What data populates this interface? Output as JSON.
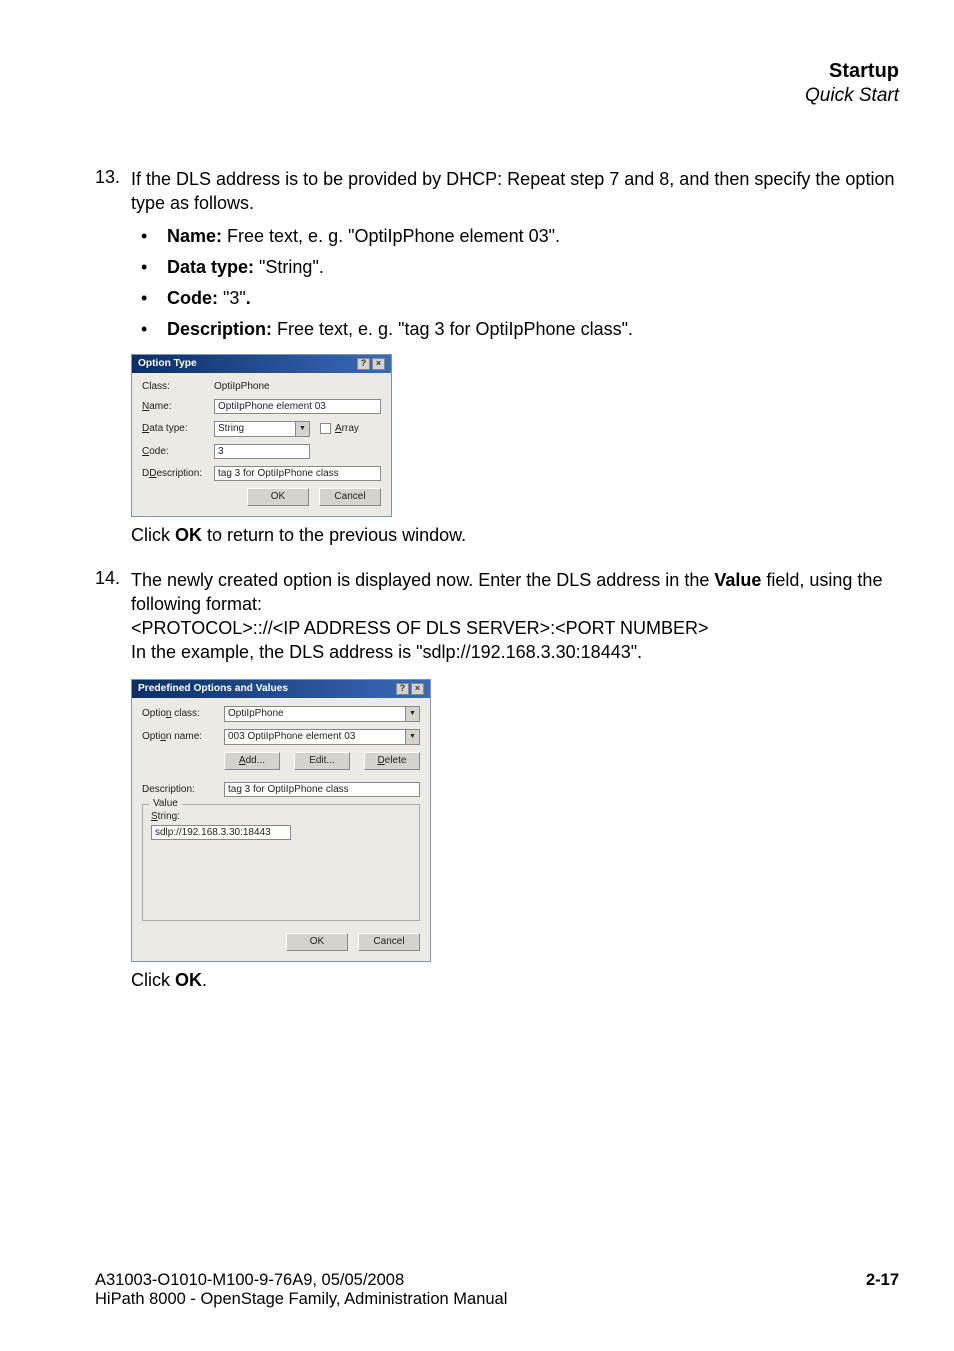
{
  "header": {
    "title": "Startup",
    "sub": "Quick Start"
  },
  "step13": {
    "num": "13.",
    "text": "If the DLS address is to be provided by DHCP: Repeat step 7 and 8, and then specify the option type as follows.",
    "bullets": [
      {
        "label": "Name:",
        "rest": " Free text, e. g. \"OptiIpPhone element 03\"."
      },
      {
        "label": "Data type:",
        "rest": " \"String\"."
      },
      {
        "label": "Code:",
        "rest": " \"3\"",
        "trail": "."
      },
      {
        "label": "Description:",
        "rest": " Free text, e. g. \"tag 3 for OptiIpPhone class\"."
      }
    ],
    "after": {
      "pre": "Click ",
      "b": "OK",
      "post": " to return to the previous window."
    }
  },
  "dlg1": {
    "title": "Option Type",
    "labels": {
      "class": "Class:",
      "name_u": "N",
      "name": "ame:",
      "dtype_u": "D",
      "dtype": "ata type:",
      "code_u": "C",
      "code": "ode:",
      "desc_u": "D",
      "desc": "escription:",
      "array_u": "A",
      "array": "rray"
    },
    "values": {
      "class": "OptiIpPhone",
      "name": "OptiIpPhone element 03",
      "dtype": "String",
      "code": "3",
      "desc": "tag 3 for OptiIpPhone class"
    },
    "btn_ok": "OK",
    "btn_cancel": "Cancel",
    "q": "?",
    "x": "×"
  },
  "step14": {
    "num": "14.",
    "l1a": "The newly created option is displayed now. Enter the DLS address in the ",
    "l1b": "Value",
    "l1c": " field, using the following format:",
    "l2": "<PROTOCOL>:://<IP ADDRESS OF DLS SERVER>:<PORT NUMBER>",
    "l3": "In the example, the DLS address is \"sdlp://192.168.3.30:18443\".",
    "after": {
      "pre": "Click ",
      "b": "OK",
      "post": "."
    }
  },
  "dlg2": {
    "title": "Predefined Options and Values",
    "labels": {
      "opclass_pre": "Optio",
      "opclass_u": "n",
      "opclass_post": " class:",
      "opname_pre": "Opti",
      "opname_u": "o",
      "opname_post": "n name:",
      "desc": "Description:",
      "value": "Value",
      "string_u": "S",
      "string": "tring:"
    },
    "values": {
      "opclass": "OptiIpPhone",
      "opname": "003 OptiIpPhone element 03",
      "desc": "tag 3 for OptiIpPhone class",
      "string": "sdlp://192.168.3.30:18443"
    },
    "btn_add_u": "A",
    "btn_add": "dd...",
    "btn_edit": "Edit...",
    "btn_del_u": "D",
    "btn_del": "elete",
    "btn_ok": "OK",
    "btn_cancel": "Cancel",
    "q": "?",
    "x": "×"
  },
  "footer": {
    "l1": "A31003-O1010-M100-9-76A9, 05/05/2008",
    "l2": "HiPath 8000 - OpenStage Family, Administration Manual",
    "page": "2-17"
  }
}
